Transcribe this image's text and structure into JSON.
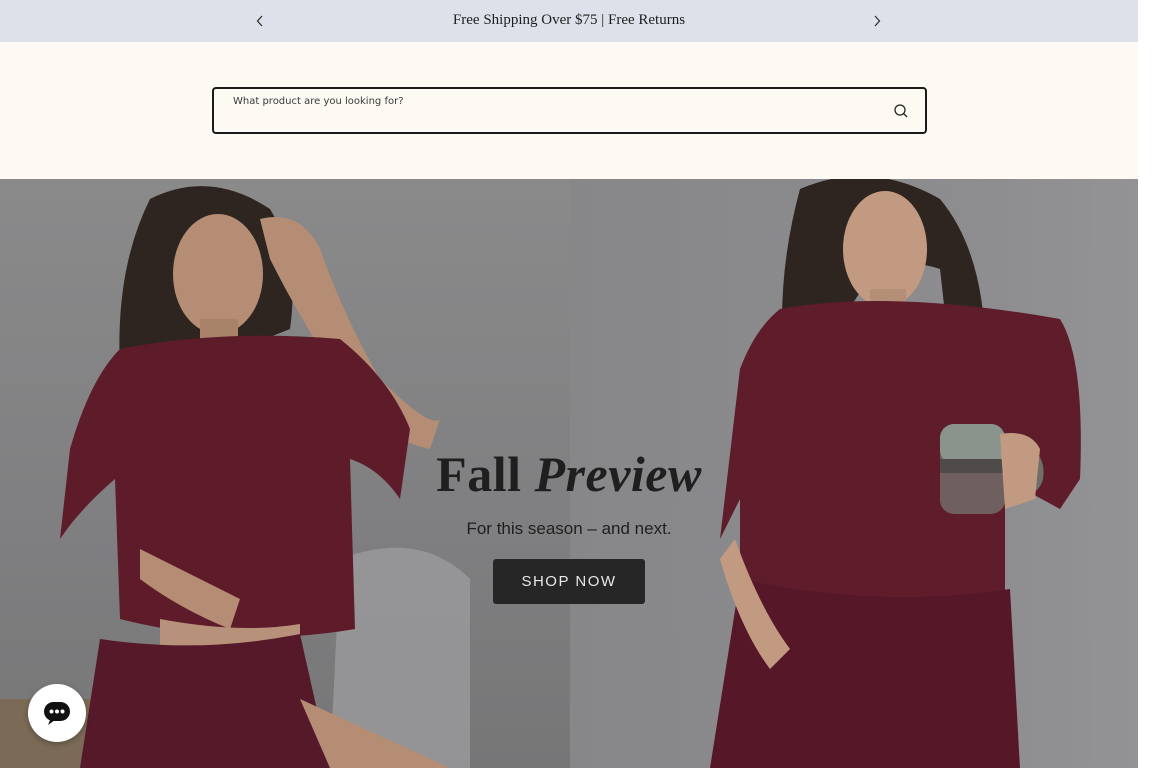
{
  "announcement": {
    "message": "Free Shipping Over $75 | Free Returns",
    "prev_icon": "chevron-left-icon",
    "next_icon": "chevron-right-icon"
  },
  "search": {
    "placeholder": "What product are you looking for?",
    "value": "",
    "icon": "search-icon"
  },
  "hero": {
    "title_plain": "Fall",
    "title_italic": "Preview",
    "subtitle": "For this season – and next.",
    "cta_label": "SHOP NOW"
  },
  "chat": {
    "icon": "chat-bubble-icon"
  },
  "colors": {
    "announcement_bg": "#dde2ea",
    "header_bg": "#fdfaf4",
    "garment": "#6b1f2e",
    "cta_bg": "#262626"
  }
}
